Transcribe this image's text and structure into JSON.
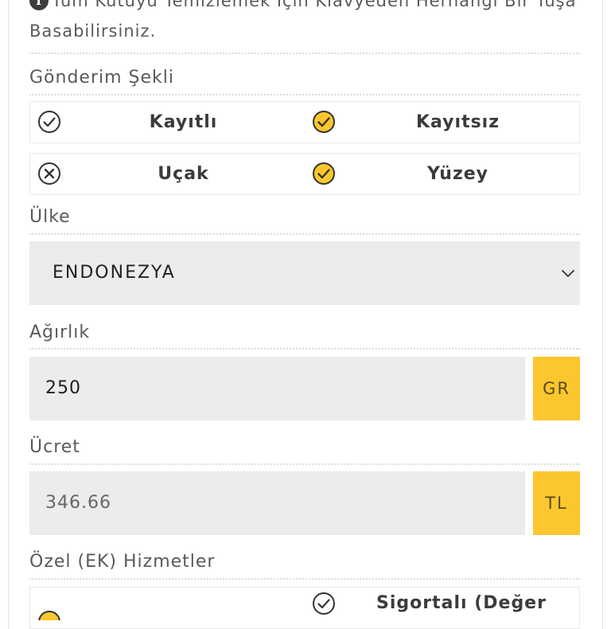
{
  "info": {
    "text": "Tüm Kutuyu Temizlemek İçin Klavyeden Herhangi Bir Tuşa Basabilirsiniz."
  },
  "shipping": {
    "label": "Gönderim Şekli",
    "row1": [
      {
        "label": "Kayıtlı",
        "state": "unchecked"
      },
      {
        "label": "Kayıtsız",
        "state": "checked"
      }
    ],
    "row2": [
      {
        "label": "Uçak",
        "state": "disabled"
      },
      {
        "label": "Yüzey",
        "state": "checked"
      }
    ]
  },
  "country": {
    "label": "Ülke",
    "value": "ENDONEZYA"
  },
  "weight": {
    "label": "Ağırlık",
    "value": "250",
    "unit": "GR"
  },
  "price": {
    "label": "Ücret",
    "value": "346.66",
    "unit": "TL"
  },
  "extras": {
    "label": "Özel (EK) Hizmetler",
    "option2_label": "Sigortalı (Değer"
  },
  "colors": {
    "accent": "#fcc72e",
    "field_bg": "#ececec"
  }
}
